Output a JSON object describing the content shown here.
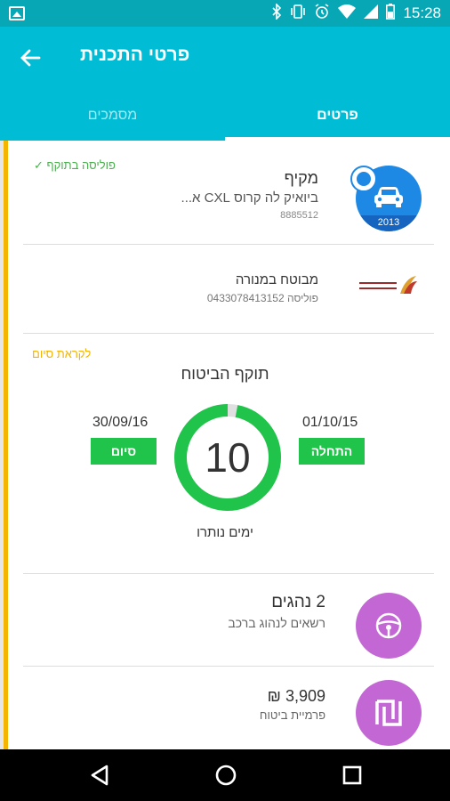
{
  "statusbar": {
    "time": "15:28"
  },
  "appbar": {
    "title": "פרטי התכנית"
  },
  "tabs": [
    {
      "label": "פרטים",
      "active": true
    },
    {
      "label": "מסמכים",
      "active": false
    }
  ],
  "vehicle": {
    "policy_status": "פוליסה בתוקף ✓",
    "title": "מקיף",
    "model": "ביואיק לה קרוס CXL א...",
    "number": "8885512",
    "year": "2013",
    "icon": "car-icon"
  },
  "insurer": {
    "name": "מבוטח במנורה",
    "policy_label": "פוליסה 0433078413152",
    "logo_text": "מנורה מבטחים"
  },
  "validity": {
    "expiry_note": "לקראת סיום",
    "title": "תוקף הביטוח",
    "start_date": "01/10/15",
    "start_label": "התחלה",
    "end_date": "30/09/16",
    "end_label": "סיום",
    "days_left": "10",
    "days_label": "ימים נותרו",
    "remaining_fraction": 0.97
  },
  "drivers": {
    "count_label": "2 נהגים",
    "desc": "רשאים לנהוג ברכב",
    "icon": "steering-wheel-icon"
  },
  "premium": {
    "amount": "₪ 3,909",
    "label": "פרמיית ביטוח",
    "icon": "shekel-icon"
  },
  "colors": {
    "appbar": "#00bcd4",
    "statusbar": "#07a7b6",
    "accent_green": "#21c44a",
    "accent_yellow": "#f4b400",
    "purple": "#c267d4",
    "blue": "#1e88e5"
  }
}
